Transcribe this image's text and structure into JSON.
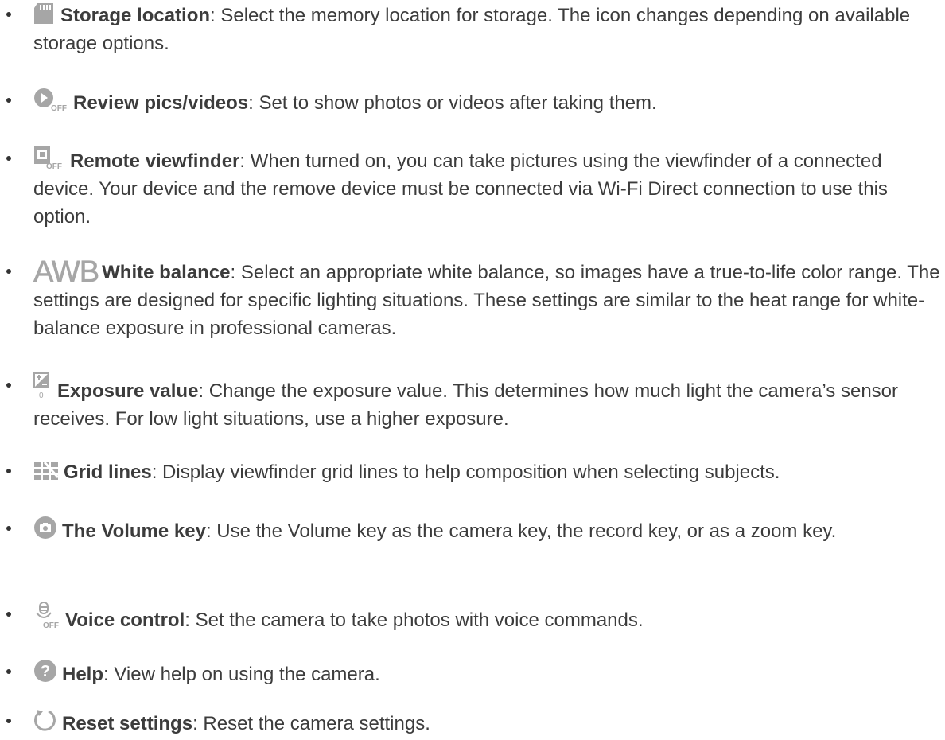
{
  "items": [
    {
      "icon": "sd-card-icon",
      "term": "Storage location",
      "desc": ": Select the memory location for storage. The icon changes depending on available storage options."
    },
    {
      "icon": "review-off-icon",
      "term": "Review pics/videos",
      "desc": ": Set to show photos or videos after taking them."
    },
    {
      "icon": "remote-viewfinder-off-icon",
      "term": "Remote viewfinder",
      "desc": ": When turned on, you can take pictures using the viewfinder of a connected device. Your device and the remove device must be connected via Wi-Fi Direct connection to use this option."
    },
    {
      "icon": "awb-icon",
      "icon_text": "AWB",
      "term": "White balance",
      "desc": ": Select an appropriate white balance, so images have a true-to-life color range. The settings are designed for specific lighting situations. These settings are similar to the heat range for white-balance exposure in professional cameras."
    },
    {
      "icon": "exposure-icon",
      "term": "Exposure value",
      "desc": ": Change the exposure value. This determines how much light the camera’s sensor receives. For low light situations, use a higher exposure."
    },
    {
      "icon": "grid-lines-icon",
      "term": "Grid lines",
      "desc": ": Display viewfinder grid lines to help composition when selecting subjects."
    },
    {
      "icon": "camera-key-icon",
      "term": "The Volume key",
      "desc": ": Use the Volume key as the camera key, the record key, or as a zoom key."
    },
    {
      "icon": "voice-control-off-icon",
      "term": "Voice control",
      "desc": ": Set the camera to take photos with voice commands."
    },
    {
      "icon": "help-icon",
      "term": "Help",
      "desc": ": View help on using the camera."
    },
    {
      "icon": "reset-icon",
      "term": "Reset settings",
      "desc": ": Reset the camera settings."
    }
  ],
  "colors": {
    "text": "#3c3c3c",
    "icon": "#a6a6a6"
  }
}
